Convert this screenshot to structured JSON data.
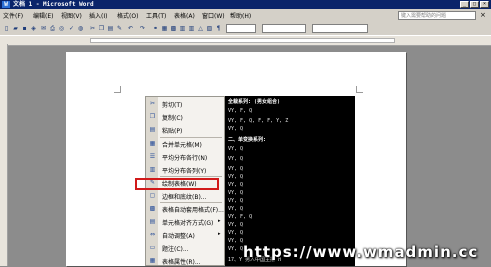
{
  "window": {
    "title": "文档 1 - Microsoft Word",
    "app_icon": "word-icon"
  },
  "menubar": {
    "items": [
      "文件(F)",
      "编辑(E)",
      "视图(V)",
      "插入(I)",
      "格式(O)",
      "工具(T)",
      "表格(A)",
      "窗口(W)",
      "帮助(H)"
    ],
    "help_placeholder": "键入需要帮助的问题",
    "close_glyph": "×"
  },
  "toolbar": {
    "buttons": [
      "new-icon",
      "open-icon",
      "save-icon",
      "permission-icon",
      "email-icon",
      "print-icon",
      "preview-icon",
      "spelling-icon",
      "research-icon",
      "cut-icon",
      "copy-icon",
      "paste-icon",
      "format-painter-icon",
      "undo-icon",
      "redo-icon",
      "hyperlink-icon",
      "table-icon",
      "insert-table-icon",
      "excel-icon",
      "columns-icon",
      "drawing-icon",
      "docmap-icon",
      "showhide-icon"
    ],
    "zoom_value": "",
    "style_value": "",
    "font_value": ""
  },
  "document": {
    "lines": [
      {
        "text": "全裁系列: (男女组合)",
        "bold": true
      },
      {
        "text": "VY, F, Q",
        "bold": false
      },
      {
        "text": "VY, F, Q, F, F, Y, Z",
        "bold": false
      },
      {
        "text": "VY, Q",
        "bold": false
      },
      {
        "text": "二、单变换系列:",
        "bold": true
      },
      {
        "text": "VY, Q",
        "bold": false
      },
      {
        "text": "VY, Q",
        "bold": false
      },
      {
        "text": "VY, Q",
        "bold": false
      },
      {
        "text": "VY, Q",
        "bold": false
      },
      {
        "text": "VY, Q",
        "bold": false
      },
      {
        "text": "VY, Q",
        "bold": false
      },
      {
        "text": "VY, Q",
        "bold": false
      },
      {
        "text": "VY, Q",
        "bold": false
      },
      {
        "text": "VY, F, Q",
        "bold": false
      },
      {
        "text": "VY, Q",
        "bold": false
      },
      {
        "text": "VY, Q",
        "bold": false
      },
      {
        "text": "VY, Q",
        "bold": false
      },
      {
        "text": "VY, Q",
        "bold": false
      },
      {
        "text": "17、Y 男人中国主播 H",
        "bold": false
      }
    ]
  },
  "context_menu": {
    "items": [
      {
        "label": "剪切(T)",
        "icon": "scissors-icon",
        "submenu": false
      },
      {
        "label": "复制(C)",
        "icon": "copy-icon",
        "submenu": false
      },
      {
        "label": "粘贴(P)",
        "icon": "paste-icon",
        "submenu": false
      },
      {
        "label": "合并单元格(M)",
        "icon": "merge-cells-icon",
        "submenu": false
      },
      {
        "label": "平均分布各行(N)",
        "icon": "distribute-rows-icon",
        "submenu": false
      },
      {
        "label": "平均分布各列(Y)",
        "icon": "distribute-columns-icon",
        "submenu": false
      },
      {
        "label": "绘制表格(W)",
        "icon": "draw-table-icon",
        "submenu": false
      },
      {
        "label": "边框和底纹(B)...",
        "icon": "borders-icon",
        "submenu": false
      },
      {
        "label": "表格自动套用格式(F)...",
        "icon": "autoformat-icon",
        "submenu": false
      },
      {
        "label": "单元格对齐方式(G)",
        "icon": "align-icon",
        "submenu": true
      },
      {
        "label": "自动调整(A)",
        "icon": "autofit-icon",
        "submenu": true
      },
      {
        "label": "题注(C)...",
        "icon": "caption-icon",
        "submenu": false
      },
      {
        "label": "表格属性(R)...",
        "icon": "table-properties-icon",
        "submenu": false
      }
    ],
    "highlighted_index": 7,
    "highlight_color": "#d11a1a"
  },
  "watermark": {
    "text": "https://www.wmadmin.cc"
  }
}
